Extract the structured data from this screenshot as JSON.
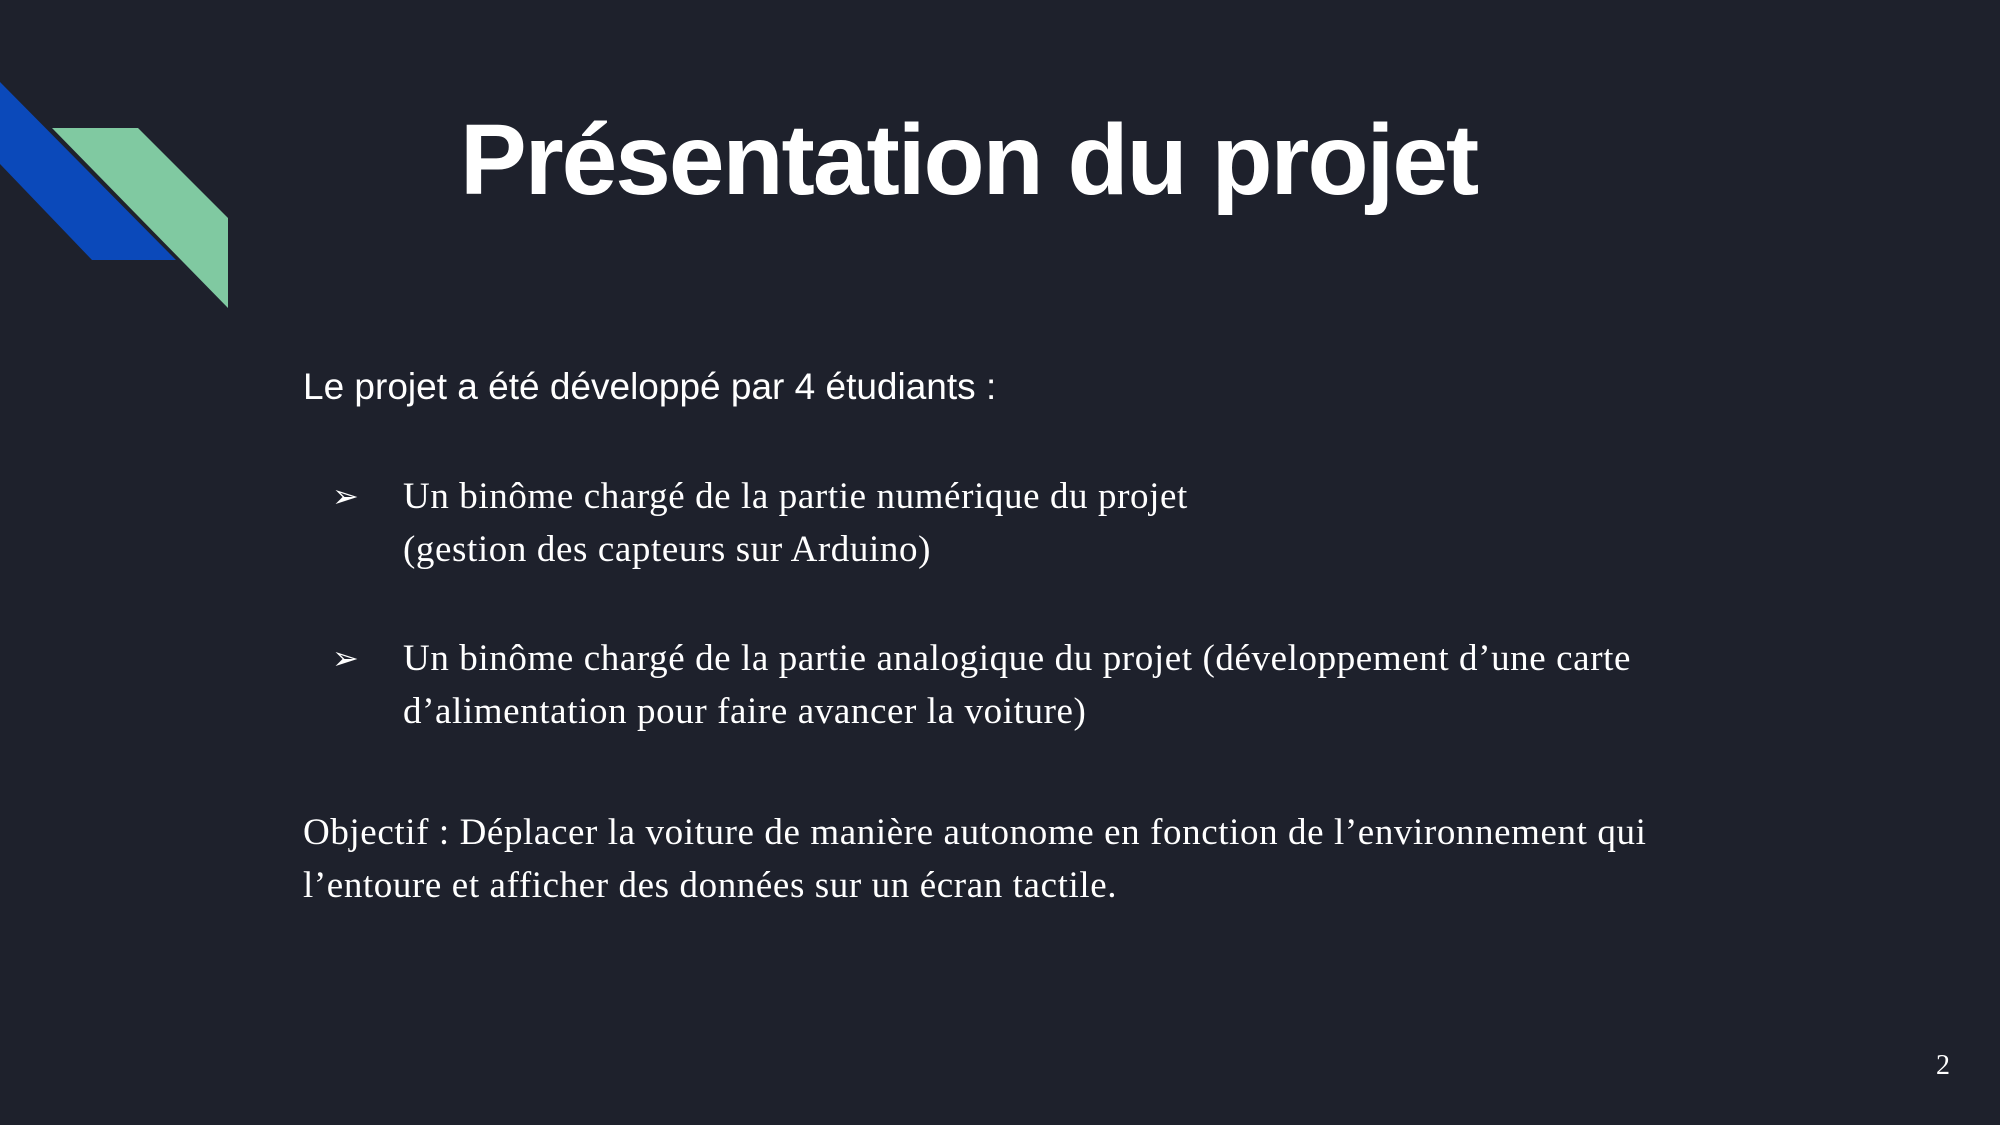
{
  "slide": {
    "title": "Présentation du projet",
    "intro": "Le projet a été développé par 4 étudiants :",
    "bullets": [
      {
        "marker": "➢",
        "lines": [
          "Un binôme chargé de la partie numérique du projet",
          "(gestion des capteurs sur Arduino)"
        ]
      },
      {
        "marker": "➢",
        "lines": [
          "Un binôme chargé de la partie analogique du projet (développement d’une carte",
          "d’alimentation pour faire avancer la voiture)"
        ]
      }
    ],
    "objective": {
      "lines": [
        "Objectif : Déplacer la voiture de manière autonome en fonction de l’environnement qui",
        "l’entoure et afficher des données sur un écran tactile."
      ]
    },
    "page_number": "2"
  },
  "colors": {
    "background": "#1e212c",
    "accent_blue": "#0b49ba",
    "accent_green": "#80c9a1",
    "text": "#ffffff"
  }
}
